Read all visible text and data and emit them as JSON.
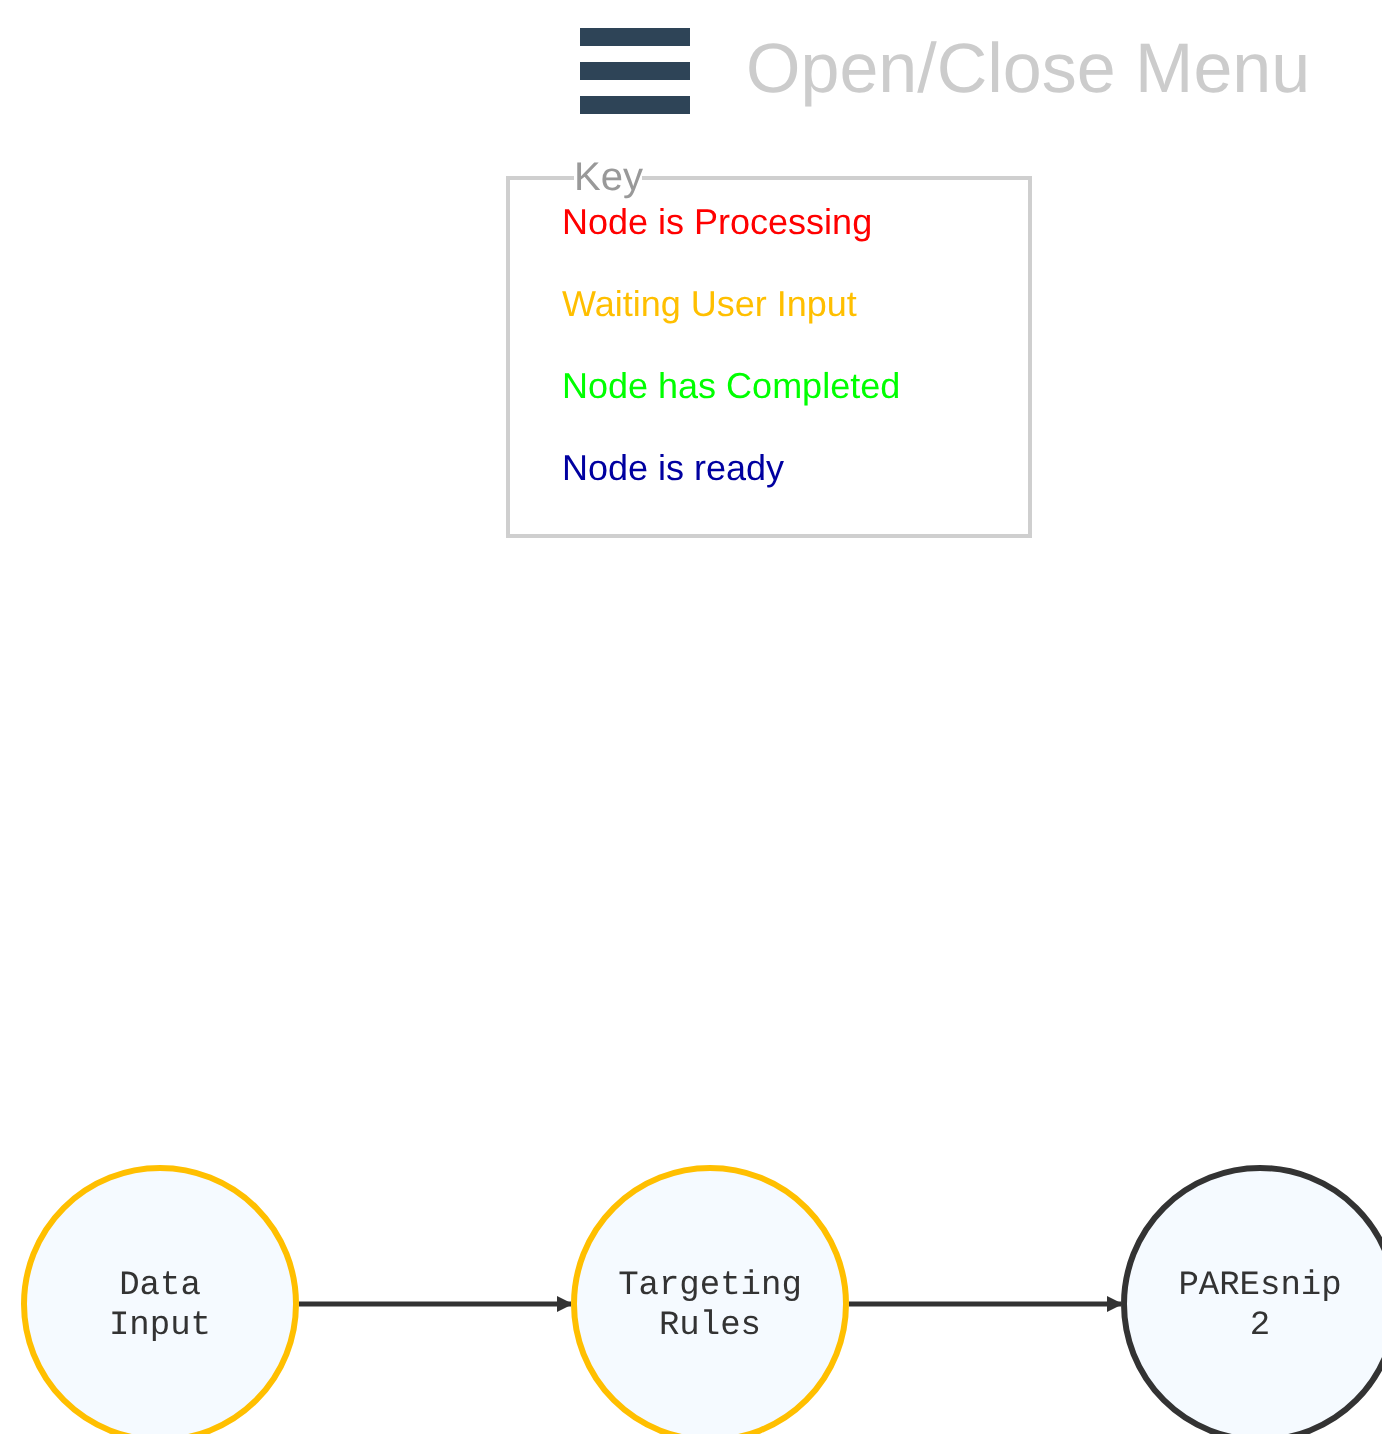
{
  "menu_toggle": {
    "label": "Open/Close Menu"
  },
  "key": {
    "title": "Key",
    "items": [
      {
        "label": "Node is Processing",
        "color": "#ff0000"
      },
      {
        "label": "Waiting User Input",
        "color": "#ffbf00"
      },
      {
        "label": "Node has Completed",
        "color": "#00ff00"
      },
      {
        "label": "Node is ready",
        "color": "#0000a0"
      }
    ]
  },
  "diagram": {
    "nodes": [
      {
        "label_lines": [
          "Data",
          "Input"
        ],
        "color": "#ffbf00"
      },
      {
        "label_lines": [
          "Targeting",
          "Rules"
        ],
        "color": "#ffbf00"
      },
      {
        "label_lines": [
          "PAREsnip",
          "2"
        ],
        "color": "#333333"
      }
    ]
  }
}
